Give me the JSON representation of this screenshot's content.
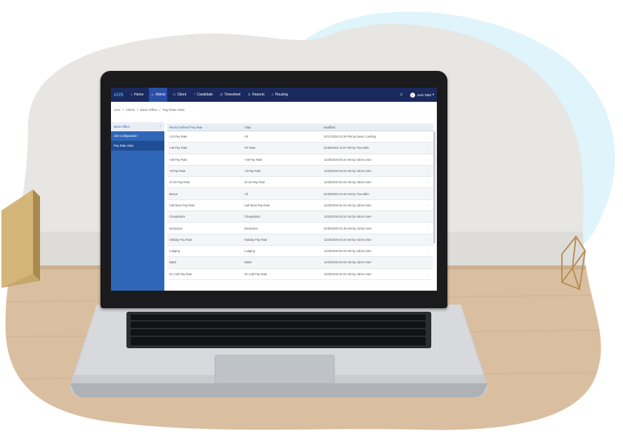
{
  "app": {
    "brand": "cUS",
    "nav": [
      {
        "label": "Home",
        "icon": "home-icon",
        "glyph": "⌂"
      },
      {
        "label": "Admin",
        "icon": "user-icon",
        "glyph": "☺"
      },
      {
        "label": "Client",
        "icon": "briefcase-icon",
        "glyph": "▭"
      },
      {
        "label": "Candidate",
        "icon": "candidate-icon",
        "glyph": "◔"
      },
      {
        "label": "Timesheet",
        "icon": "clock-icon",
        "glyph": "◷"
      },
      {
        "label": "Reports",
        "icon": "person-icon",
        "glyph": "♙"
      },
      {
        "label": "Housing",
        "icon": "house-icon",
        "glyph": "⌂"
      }
    ],
    "active_nav": "Admin",
    "user": {
      "name": "Josh Tabit",
      "initial": "J",
      "caret": "▾"
    },
    "bell_glyph": "♫"
  },
  "breadcrumb": [
    "ome",
    "/",
    "Admin",
    "/",
    "Back Office",
    "/",
    "Pay Rate Alias"
  ],
  "sidebar": {
    "header": "Back Office",
    "header_caret": "⌃",
    "items": [
      "Job Configuration",
      "Pay Rate Alias"
    ]
  },
  "table": {
    "columns": [
      "Renna Defined Pay Rate",
      "Alias",
      "Modified"
    ],
    "sort_glyph": "↑",
    "rows": [
      {
        "name": "<12 Pay Rate",
        "alias": "All",
        "modified": "01/17/2020 02:29 PM by Devin Cushing"
      },
      {
        "name": "<40 Pay Rate",
        "alias": "OT Rate",
        "modified": "01/08/2020 11:57 PM by Tina Mihe"
      },
      {
        "name": "<48 Pay Rate",
        "alias": "<48 Pay Rate",
        "modified": "11/20/2019 04:22 AM by Admin User"
      },
      {
        "name": "<8 Pay Rate",
        "alias": "<8 Pay Rate",
        "modified": "11/20/2019 04:22 AM by Admin User"
      },
      {
        "name": "37-40 Pay Rate",
        "alias": "37-40 Pay Rate",
        "modified": "11/20/2019 04:22 AM by Admin User"
      },
      {
        "name": "Bonus",
        "alias": "All",
        "modified": "01/09/2020 01:00 AM by Tina Mihe"
      },
      {
        "name": "Call Back Pay Rate",
        "alias": "Call Back Pay Rate",
        "modified": "11/20/2019 04:22 AM by Admin User"
      },
      {
        "name": "Chargeback",
        "alias": "Chargeback",
        "modified": "11/20/2019 04:22 AM by Admin User"
      },
      {
        "name": "Deduction",
        "alias": "Deduction",
        "modified": "01/06/2020 01:30 AM by Admin User"
      },
      {
        "name": "Holiday Pay Rate",
        "alias": "Holiday Pay Rate",
        "modified": "11/20/2019 04:22 AM by Admin User"
      },
      {
        "name": "Lodging",
        "alias": "Lodging",
        "modified": "11/20/2019 04:22 AM by Admin User"
      },
      {
        "name": "M&IE",
        "alias": "M&IE",
        "modified": "11/20/2019 04:22 AM by Admin User"
      },
      {
        "name": "On Call Pay Rate",
        "alias": "On Call Pay Rate",
        "modified": "11/20/2019 04:22 AM by Admin User"
      }
    ],
    "row_menu_glyph": "⋮"
  },
  "colors": {
    "nav_bg": "#1a2a5e",
    "sidebar_bg": "#2f66b8",
    "accent_blob": "#dff4fb"
  }
}
